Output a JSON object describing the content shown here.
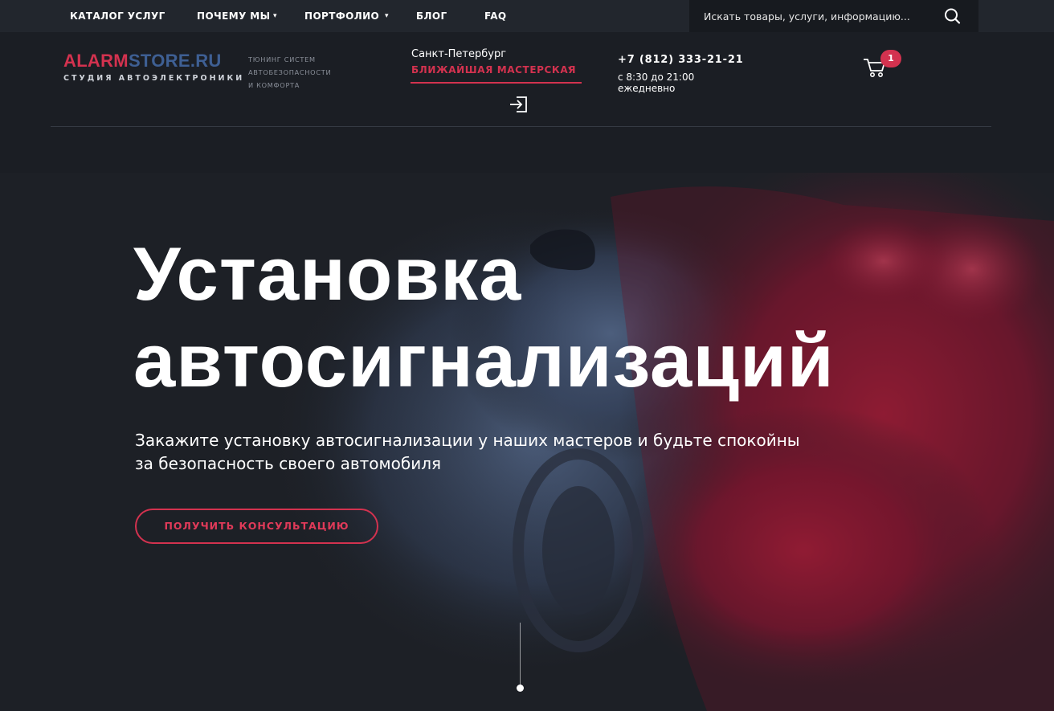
{
  "topnav": {
    "items": [
      {
        "label": "КАТАЛОГ УСЛУГ",
        "has_dropdown": false
      },
      {
        "label": "ПОЧЕМУ МЫ",
        "has_dropdown": true
      },
      {
        "label": "ПОРТФОЛИО",
        "has_dropdown": true
      },
      {
        "label": "БЛОГ",
        "has_dropdown": false
      },
      {
        "label": "FAQ",
        "has_dropdown": false
      }
    ],
    "caret": "▾",
    "search": {
      "placeholder": "Искать товары, услуги, информацию...",
      "icon": "search-icon"
    }
  },
  "header": {
    "logo": {
      "part1": "ALARM",
      "part2": "STORE",
      "part3": ".RU",
      "subtitle": "СТУДИЯ АВТОЭЛЕКТРОНИКИ"
    },
    "tagline": [
      "ТЮНИНГ СИСТЕМ",
      "АВТОБЕЗОПАСНОСТИ",
      "И КОМФОРТА"
    ],
    "city": "Санкт-Петербург",
    "workshop_label": "БЛИЖАЙШАЯ МАСТЕРСКАЯ",
    "workshop_caret": "▾",
    "login_icon": "login-icon",
    "phone": "+7 (812) 333-21-21",
    "hours_line1": "с 8:30 до 21:00",
    "hours_line2": "ежедневно",
    "cart_icon": "cart-icon",
    "cart_count": "1"
  },
  "hero": {
    "title_line1": "Установка",
    "title_line2": "автосигнализаций",
    "subtitle_line1": "Закажите установку автосигнализации у наших мастеров и будьте спокойны",
    "subtitle_line2": "за безопасность своего автомобиля",
    "cta_label": "ПОЛУЧИТЬ КОНСУЛЬТАЦИЮ"
  },
  "colors": {
    "accent": "#d3324f",
    "brand_blue": "#3e5f93",
    "topbar_bg": "#22262d",
    "page_bg": "#1b1e24"
  }
}
